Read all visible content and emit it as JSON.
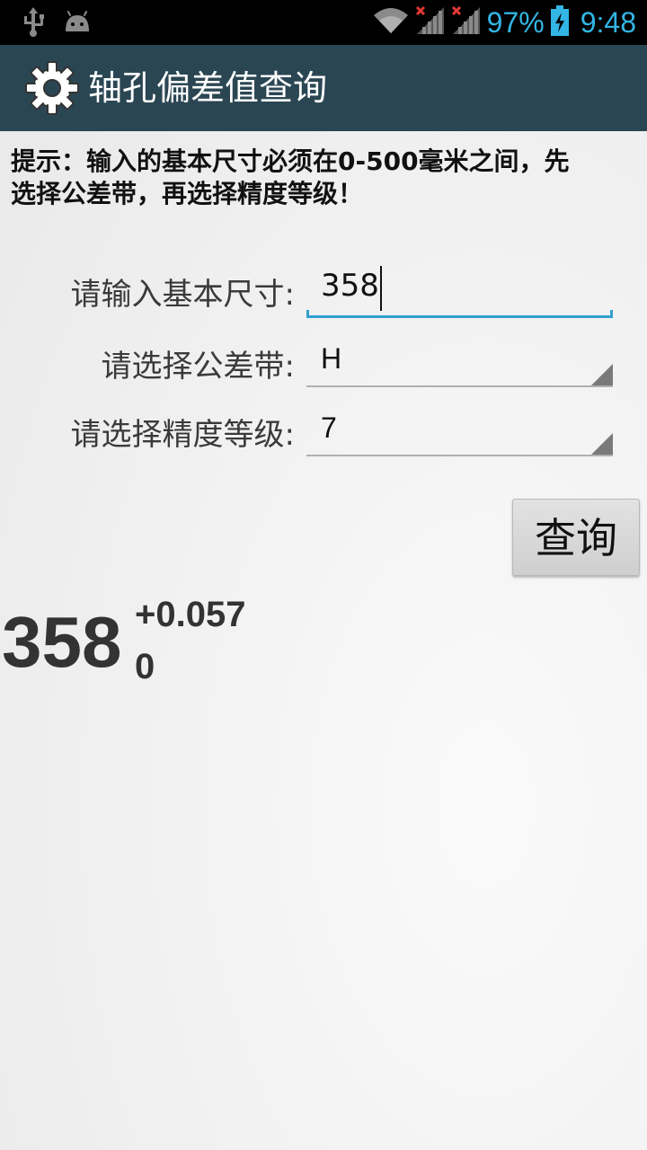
{
  "status_bar": {
    "battery_percent": "97%",
    "time": "9:48",
    "icons": [
      "usb-icon",
      "android-debug-icon",
      "wifi-icon",
      "signal-icon",
      "signal-icon",
      "battery-charging-icon"
    ],
    "accent_color": "#33b5e5"
  },
  "action_bar": {
    "title": "轴孔偏差值查询",
    "icon": "gear-icon",
    "background": "#2b4653"
  },
  "hint": "提示：输入的基本尺寸必须在0-500毫米之间，先选择公差带，再选择精度等级！",
  "form": {
    "size_label": "请输入基本尺寸:",
    "size_value": "358",
    "tolerance_label": "请选择公差带:",
    "tolerance_value": "H",
    "grade_label": "请选择精度等级:",
    "grade_value": "7"
  },
  "query_button": "查询",
  "result": {
    "base": "358",
    "upper_deviation": "+0.057",
    "lower_deviation": "0"
  }
}
